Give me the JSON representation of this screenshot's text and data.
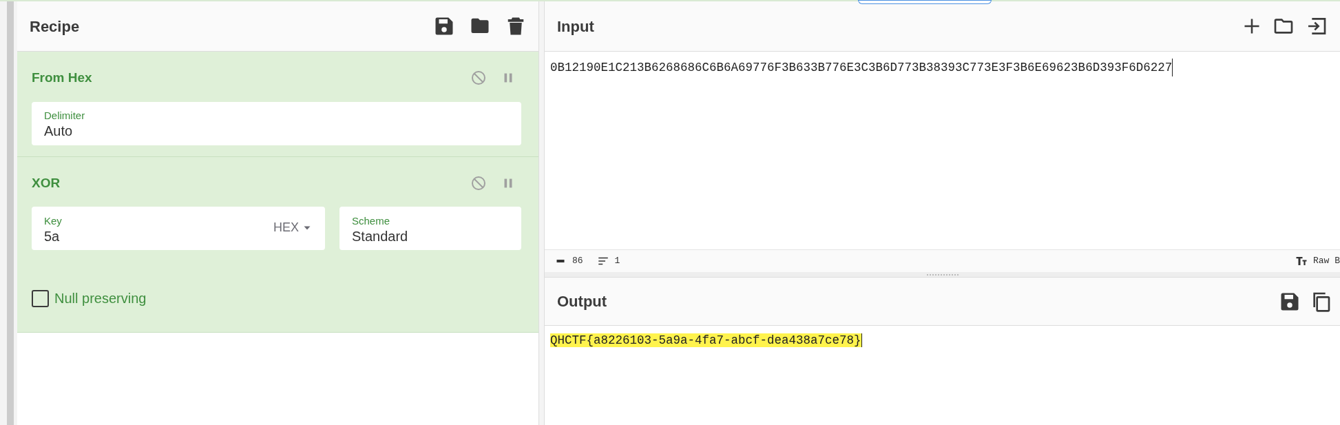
{
  "recipe": {
    "title": "Recipe",
    "operations": [
      {
        "name": "From Hex",
        "disabled": false,
        "paused": false,
        "args": [
          {
            "kind": "field",
            "label": "Delimiter",
            "value": "Auto"
          }
        ]
      },
      {
        "name": "XOR",
        "disabled": false,
        "paused": false,
        "args": [
          {
            "kind": "toggle_field",
            "label": "Key",
            "value": "5a",
            "option": "HEX"
          },
          {
            "kind": "field",
            "label": "Scheme",
            "value": "Standard"
          },
          {
            "kind": "checkbox",
            "label": "Null preserving",
            "checked": false
          }
        ]
      }
    ]
  },
  "input": {
    "title": "Input",
    "text": "0B12190E1C213B6268686C6B6A69776F3B633B776E3C3B6D773B38393C773E3F3B6E69623B6D393F6D6227",
    "length": "86",
    "lines": "1",
    "mode": "Raw B"
  },
  "output": {
    "title": "Output",
    "text": "QHCTF{a8226103-5a9a-4fa7-abcf-dea438a7ce78}",
    "highlighted": true
  }
}
